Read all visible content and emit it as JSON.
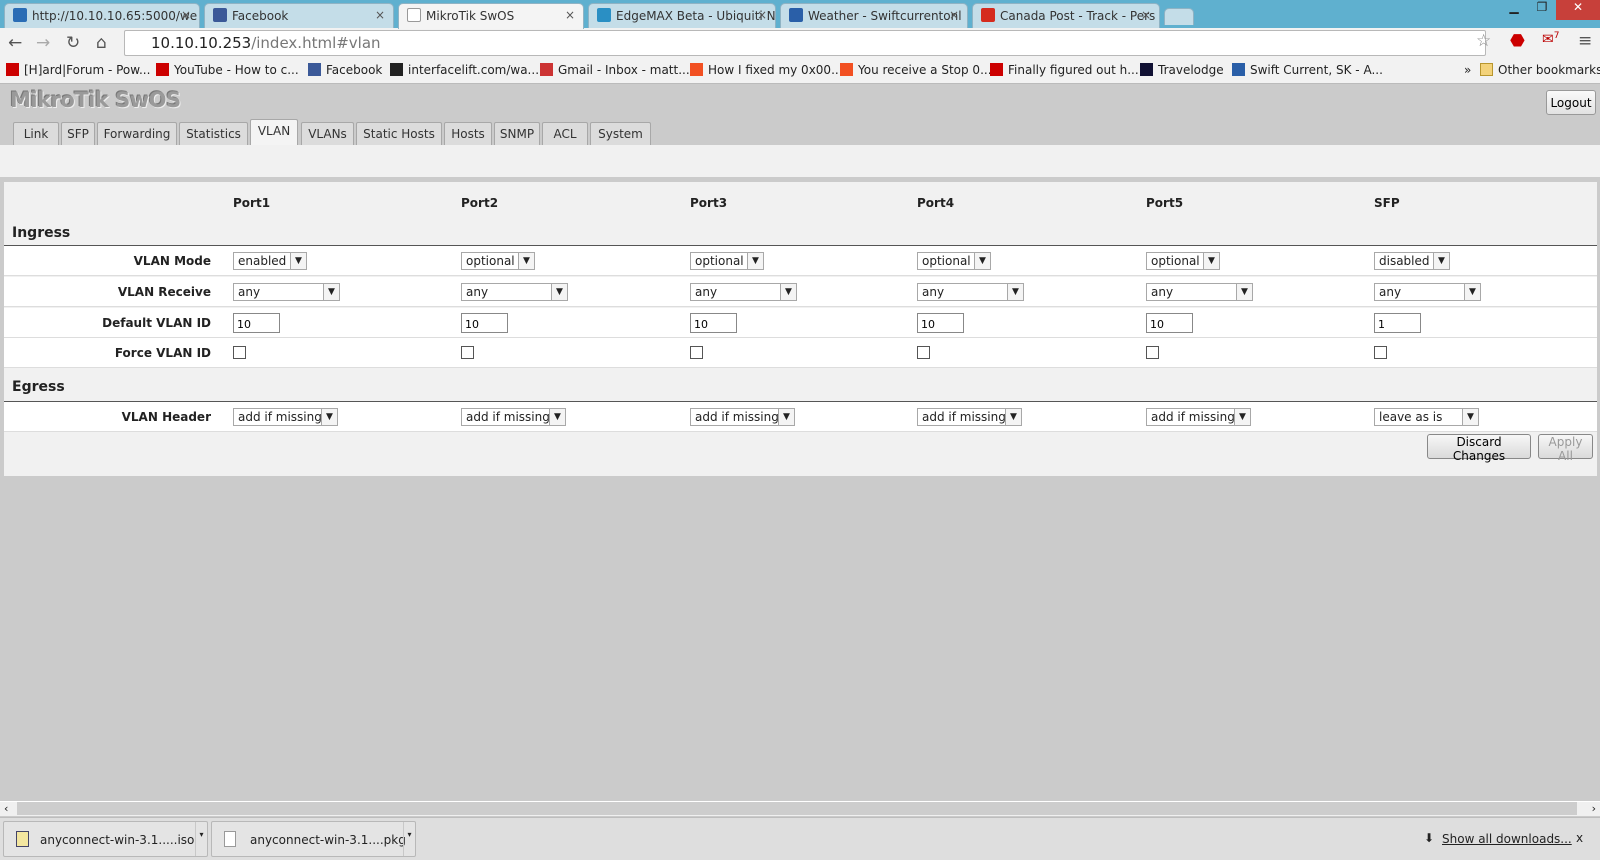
{
  "browser": {
    "tabs": [
      {
        "title": "http://10.10.10.65:5000/we",
        "icon": "dsm-icon",
        "color": "#2a6db5"
      },
      {
        "title": "Facebook",
        "icon": "facebook-icon",
        "color": "#3b5998"
      },
      {
        "title": "MikroTik SwOS",
        "icon": "page-icon",
        "color": "#ffffff",
        "active": true
      },
      {
        "title": "EdgeMAX Beta - Ubiquiti N",
        "icon": "ubiquiti-icon",
        "color": "#2a8fc4"
      },
      {
        "title": "Weather - Swiftcurrentonl",
        "icon": "globe-icon",
        "color": "#2a5fa8"
      },
      {
        "title": "Canada Post - Track - Pers",
        "icon": "canada-post-icon",
        "color": "#d52b1e"
      }
    ],
    "close_glyph": "×",
    "url_host": "10.10.10.253",
    "url_path": "/index.html#vlan",
    "extension_badge": "7",
    "bookmarks": [
      {
        "label": "[H]ard|Forum - Pow...",
        "icon": "hardforum-icon"
      },
      {
        "label": "YouTube - How to c...",
        "icon": "youtube-icon"
      },
      {
        "label": "Facebook",
        "icon": "facebook-icon"
      },
      {
        "label": "interfacelift.com/wa...",
        "icon": "ifl-icon"
      },
      {
        "label": "Gmail - Inbox - matt...",
        "icon": "gmail-icon"
      },
      {
        "label": "How I fixed my 0x00...",
        "icon": "microsoft-icon"
      },
      {
        "label": "You receive a Stop 0...",
        "icon": "microsoft-icon"
      },
      {
        "label": "Finally figured out h...",
        "icon": "hardforum-icon"
      },
      {
        "label": "Travelodge",
        "icon": "paw-icon"
      },
      {
        "label": "Swift Current, SK - A...",
        "icon": "globe-icon"
      }
    ],
    "overflow": "»",
    "other_bookmarks": "Other bookmarks"
  },
  "app": {
    "title": "MikroTik SwOS",
    "logout": "Logout",
    "tabs": [
      "Link",
      "SFP",
      "Forwarding",
      "Statistics",
      "VLAN",
      "VLANs",
      "Static Hosts",
      "Hosts",
      "SNMP",
      "ACL",
      "System"
    ],
    "active_tab": "VLAN"
  },
  "vlan": {
    "ports": [
      "Port1",
      "Port2",
      "Port3",
      "Port4",
      "Port5",
      "SFP"
    ],
    "ingress_title": "Ingress",
    "egress_title": "Egress",
    "labels": {
      "mode": "VLAN Mode",
      "receive": "VLAN Receive",
      "default_id": "Default VLAN ID",
      "force": "Force VLAN ID",
      "header": "VLAN Header"
    },
    "mode": [
      "enabled",
      "optional",
      "optional",
      "optional",
      "optional",
      "disabled"
    ],
    "receive": [
      "any",
      "any",
      "any",
      "any",
      "any",
      "any"
    ],
    "default_id": [
      "10",
      "10",
      "10",
      "10",
      "10",
      "1"
    ],
    "force": [
      false,
      false,
      false,
      false,
      false,
      false
    ],
    "header": [
      "add if missing",
      "add if missing",
      "add if missing",
      "add if missing",
      "add if missing",
      "leave as is"
    ],
    "discard": "Discard Changes",
    "apply": "Apply All"
  },
  "downloads": {
    "items": [
      "anyconnect-win-3.1.....iso",
      "anyconnect-win-3.1....pkg"
    ],
    "show_all": "Show all downloads...",
    "close": "x"
  }
}
